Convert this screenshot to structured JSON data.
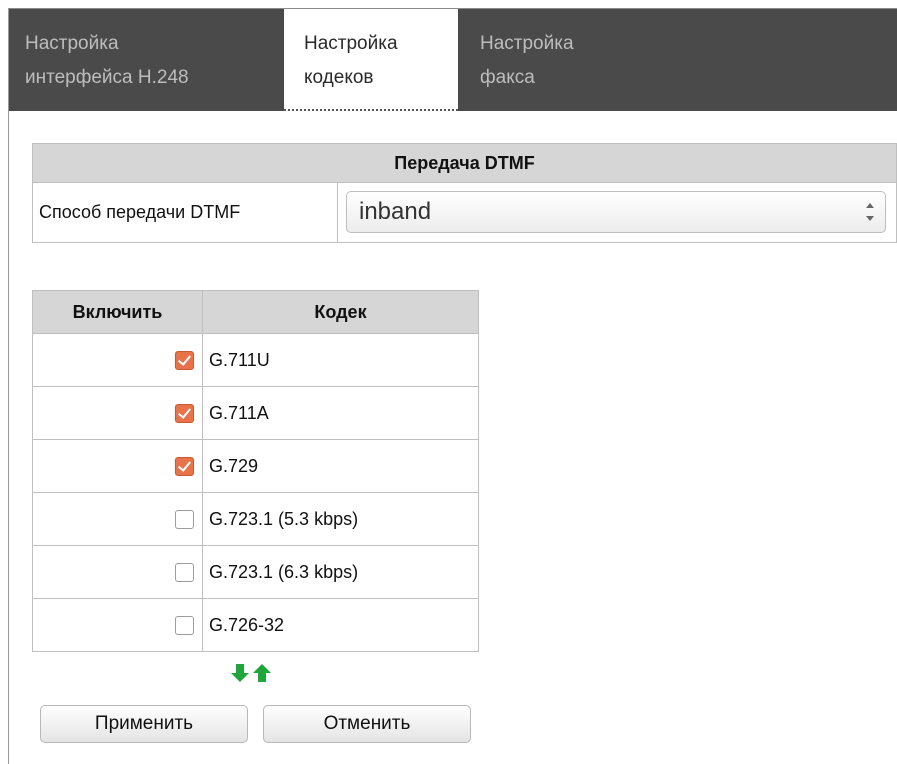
{
  "tabs": [
    {
      "line1": "Настройка",
      "line2": "интерфейса H.248",
      "active": false
    },
    {
      "line1": "Настройка",
      "line2": "кодеков",
      "active": true
    },
    {
      "line1": "Настройка",
      "line2": "факса",
      "active": false
    }
  ],
  "dtmf": {
    "header": "Передача DTMF",
    "label": "Способ передачи DTMF",
    "value": "inband"
  },
  "codecs": {
    "col_enable": "Включить",
    "col_codec": "Кодек",
    "rows": [
      {
        "name": "G.711U",
        "enabled": true
      },
      {
        "name": "G.711A",
        "enabled": true
      },
      {
        "name": "G.729",
        "enabled": true
      },
      {
        "name": "G.723.1 (5.3 kbps)",
        "enabled": false
      },
      {
        "name": "G.723.1 (6.3 kbps)",
        "enabled": false
      },
      {
        "name": "G.726-32",
        "enabled": false
      }
    ]
  },
  "buttons": {
    "apply": "Применить",
    "cancel": "Отменить"
  },
  "colors": {
    "checkbox_checked": "#e8734a",
    "arrow_green": "#1fa53a",
    "tabbar": "#4a4a4a"
  }
}
